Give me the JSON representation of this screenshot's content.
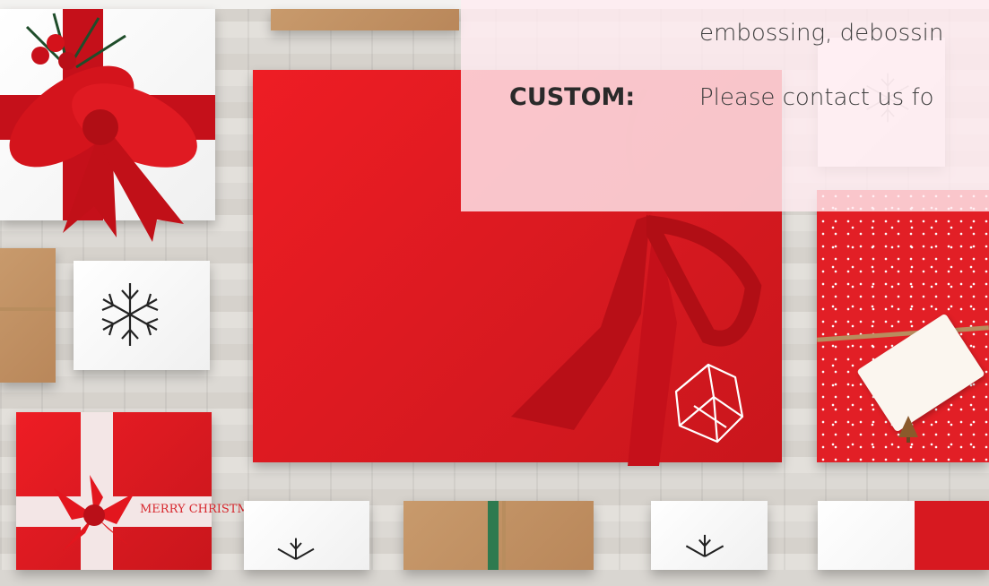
{
  "panel": {
    "line_top_partial": "embossing, debossin",
    "custom_label": "CUSTOM:",
    "custom_text": "Please contact us fo"
  },
  "box_text": {
    "merry_christmas_ribbon": "MERRY CHRISTMAS"
  },
  "colors": {
    "gift_red": "#d71920",
    "ribbon_red": "#c5101a",
    "panel_pink": "#ffecf0",
    "kraft": "#c89a6c"
  },
  "icons": [
    "snowflake-icon",
    "origami-logo-icon",
    "bow-icon",
    "tree-tag-icon"
  ]
}
